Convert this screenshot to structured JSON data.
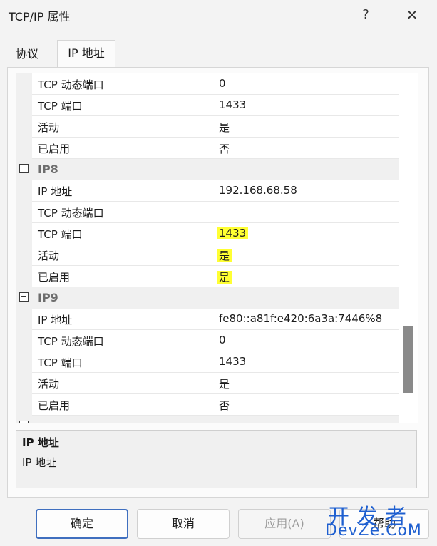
{
  "window": {
    "title": "TCP/IP 属性",
    "help_glyph": "?",
    "close_glyph": "✕"
  },
  "tabs": [
    {
      "label": "协议",
      "active": false
    },
    {
      "label": "IP 地址",
      "active": true
    }
  ],
  "grid": {
    "rows_top": [
      {
        "key": "TCP 动态端口",
        "value": "0"
      },
      {
        "key": "TCP 端口",
        "value": "1433"
      },
      {
        "key": "活动",
        "value": "是"
      },
      {
        "key": "已启用",
        "value": "否"
      }
    ],
    "groups": [
      {
        "name": "IP8",
        "toggle": "−",
        "rows": [
          {
            "key": "IP 地址",
            "value": "192.168.68.58"
          },
          {
            "key": "TCP 动态端口",
            "value": ""
          },
          {
            "key": "TCP 端口",
            "value": "1433",
            "highlight": true
          },
          {
            "key": "活动",
            "value": "是",
            "highlight": true
          },
          {
            "key": "已启用",
            "value": "是",
            "highlight": true
          }
        ]
      },
      {
        "name": "IP9",
        "toggle": "−",
        "rows": [
          {
            "key": "IP 地址",
            "value": "fe80::a81f:e420:6a3a:7446%8"
          },
          {
            "key": "TCP 动态端口",
            "value": "0"
          },
          {
            "key": "TCP 端口",
            "value": "1433"
          },
          {
            "key": "活动",
            "value": "是"
          },
          {
            "key": "已启用",
            "value": "否"
          }
        ]
      }
    ],
    "highlight_color": "#ffff33"
  },
  "description": {
    "title": "IP 地址",
    "text": "IP 地址"
  },
  "buttons": {
    "ok": "确定",
    "cancel": "取消",
    "apply": "应用(A)",
    "help": "帮助"
  },
  "watermark": {
    "line1": "开发者",
    "line2": "DevZe.CoM"
  }
}
